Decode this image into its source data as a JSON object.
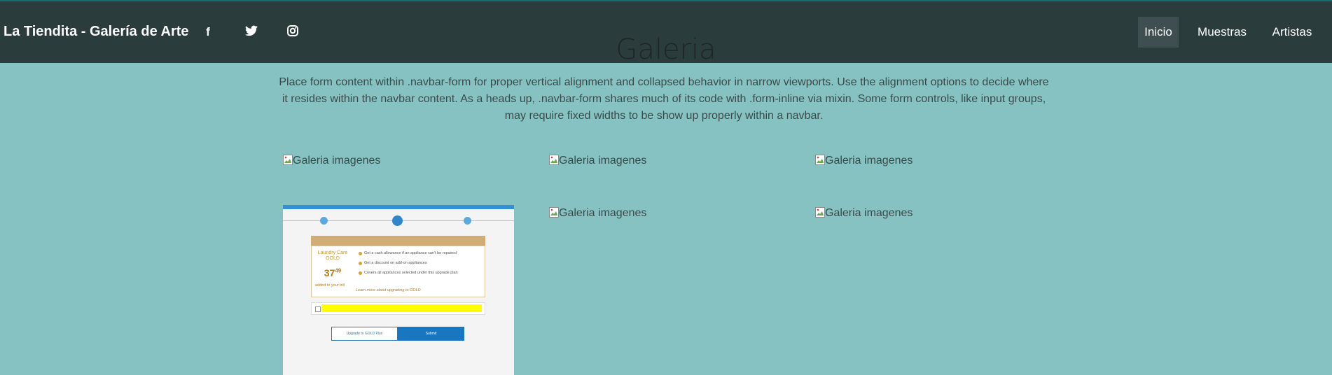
{
  "navbar": {
    "brand": "La Tiendita - Galería de Arte",
    "social": [
      {
        "icon": "facebook-icon",
        "glyph": "f"
      },
      {
        "icon": "twitter-icon"
      },
      {
        "icon": "instagram-icon"
      }
    ],
    "links": [
      {
        "label": "Inicio",
        "active": true
      },
      {
        "label": "Muestras",
        "active": false
      },
      {
        "label": "Artistas",
        "active": false
      }
    ]
  },
  "main": {
    "title": "Galeria",
    "lead": "Place form content within .navbar-form for proper vertical alignment and collapsed behavior in narrow viewports. Use the alignment options to decide where it resides within the navbar content. As a heads up, .navbar-form shares much of its code with .form-inline via mixin. Some form controls, like input groups, may require fixed widths to be show up properly within a navbar.",
    "gallery_alt": "Galeria imagenes",
    "gallery_count": 6
  },
  "thumbnail": {
    "plan_name": "Laundry Care GOLD",
    "price_whole": "37",
    "price_cents": "49",
    "price_note": "added to your bill",
    "features": [
      "Get a cash allowance if an appliance can't be repaired",
      "Get a discount on add-on appliances",
      "Covers all appliances selected under this upgrade plan"
    ],
    "more_link": "Learn more about upgrading to GOLD",
    "alt_button": "Upgrade to GOLD Plus",
    "submit_button": "Submit"
  },
  "colors": {
    "page_bg": "#86c2c2",
    "navbar_bg": "#2b3c3d",
    "active_bg": "#3f4e50"
  }
}
